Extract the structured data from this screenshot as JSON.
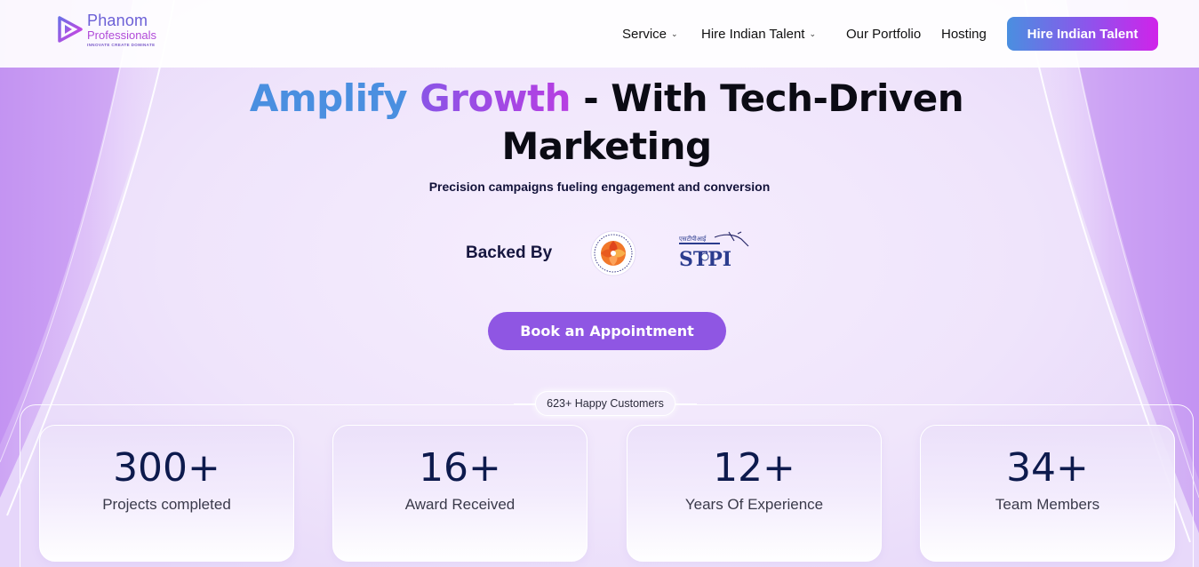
{
  "brand": {
    "name": "Phanom",
    "sub": "Professionals",
    "tagline": "INNOVATE CREATE DOMINATE"
  },
  "nav": {
    "items": [
      {
        "label": "Service",
        "has_dropdown": true
      },
      {
        "label": "Hire Indian Talent",
        "has_dropdown": true
      },
      {
        "label": "Our Portfolio",
        "has_dropdown": false
      },
      {
        "label": "Hosting",
        "has_dropdown": false
      }
    ],
    "cta": "Hire Indian Talent"
  },
  "hero": {
    "title_part1": "Amplify",
    "title_part2": "Growth",
    "title_part3": "- With Tech-Driven Marketing",
    "subtitle": "Precision campaigns fueling engagement and conversion",
    "backed_by": "Backed By",
    "partners": [
      "incubator-seal-icon",
      "stpi-logo-icon"
    ],
    "book_button": "Book an Appointment"
  },
  "stats": {
    "badge": "623+ Happy Customers",
    "items": [
      {
        "value": "300+",
        "label": "Projects completed"
      },
      {
        "value": "16+",
        "label": "Award Received"
      },
      {
        "value": "12+",
        "label": "Years Of Experience"
      },
      {
        "value": "34+",
        "label": "Team Members"
      }
    ]
  },
  "colors": {
    "accent_blue": "#4a8fe0",
    "accent_purple": "#8f56e3",
    "accent_magenta": "#d023ea",
    "background": "#efe4fb"
  }
}
